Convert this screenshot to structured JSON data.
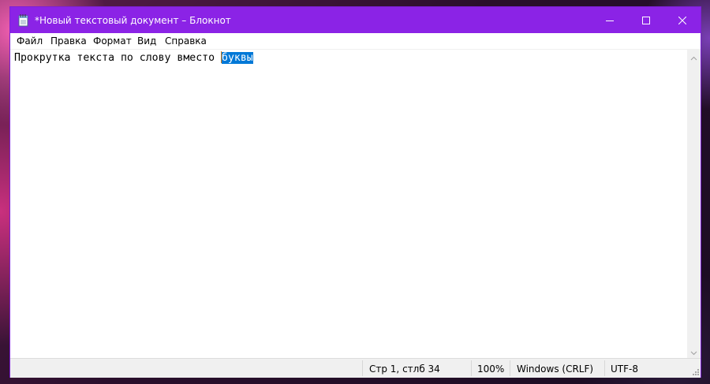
{
  "window": {
    "title": "*Новый текстовый документ – Блокнот",
    "titlebar_color": "#8b23e6",
    "icons": {
      "app": "notepad-icon",
      "minimize": "minimize-icon",
      "maximize": "maximize-icon",
      "close": "close-icon"
    }
  },
  "menu": {
    "items": [
      {
        "label": "Файл"
      },
      {
        "label": "Правка"
      },
      {
        "label": "Формат"
      },
      {
        "label": "Вид"
      },
      {
        "label": "Справка"
      }
    ]
  },
  "editor": {
    "text_before_selection": "Прокрутка текста по слову вместо ",
    "selected_text": "буквы",
    "selection_color": "#0078d7"
  },
  "statusbar": {
    "position": "Стр 1, стлб 34",
    "zoom": "100%",
    "line_endings": "Windows (CRLF)",
    "encoding": "UTF-8"
  }
}
